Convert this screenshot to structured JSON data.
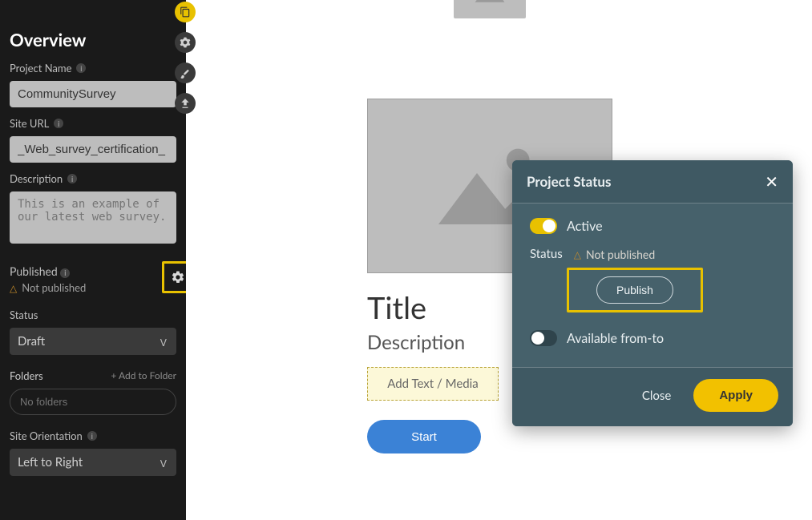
{
  "sidebar": {
    "title": "Overview",
    "project_name_label": "Project Name",
    "project_name_value": "CommunitySurvey",
    "site_url_label": "Site URL",
    "site_url_value": "_Web_survey_certification_",
    "description_label": "Description",
    "description_placeholder": "This is an example of our latest web survey.",
    "published_label": "Published",
    "not_published_text": "Not published",
    "status_label": "Status",
    "status_value": "Draft",
    "folders_label": "Folders",
    "add_to_folder": "+ Add to Folder",
    "folders_placeholder": "No folders",
    "orientation_label": "Site Orientation",
    "orientation_value": "Left to Right"
  },
  "canvas": {
    "title": "Title",
    "description": "Description",
    "add_media": "Add Text / Media",
    "start": "Start"
  },
  "modal": {
    "title": "Project Status",
    "active_label": "Active",
    "status_label": "Status",
    "not_published": "Not published",
    "publish_button": "Publish",
    "available_label": "Available from-to",
    "close": "Close",
    "apply": "Apply"
  }
}
